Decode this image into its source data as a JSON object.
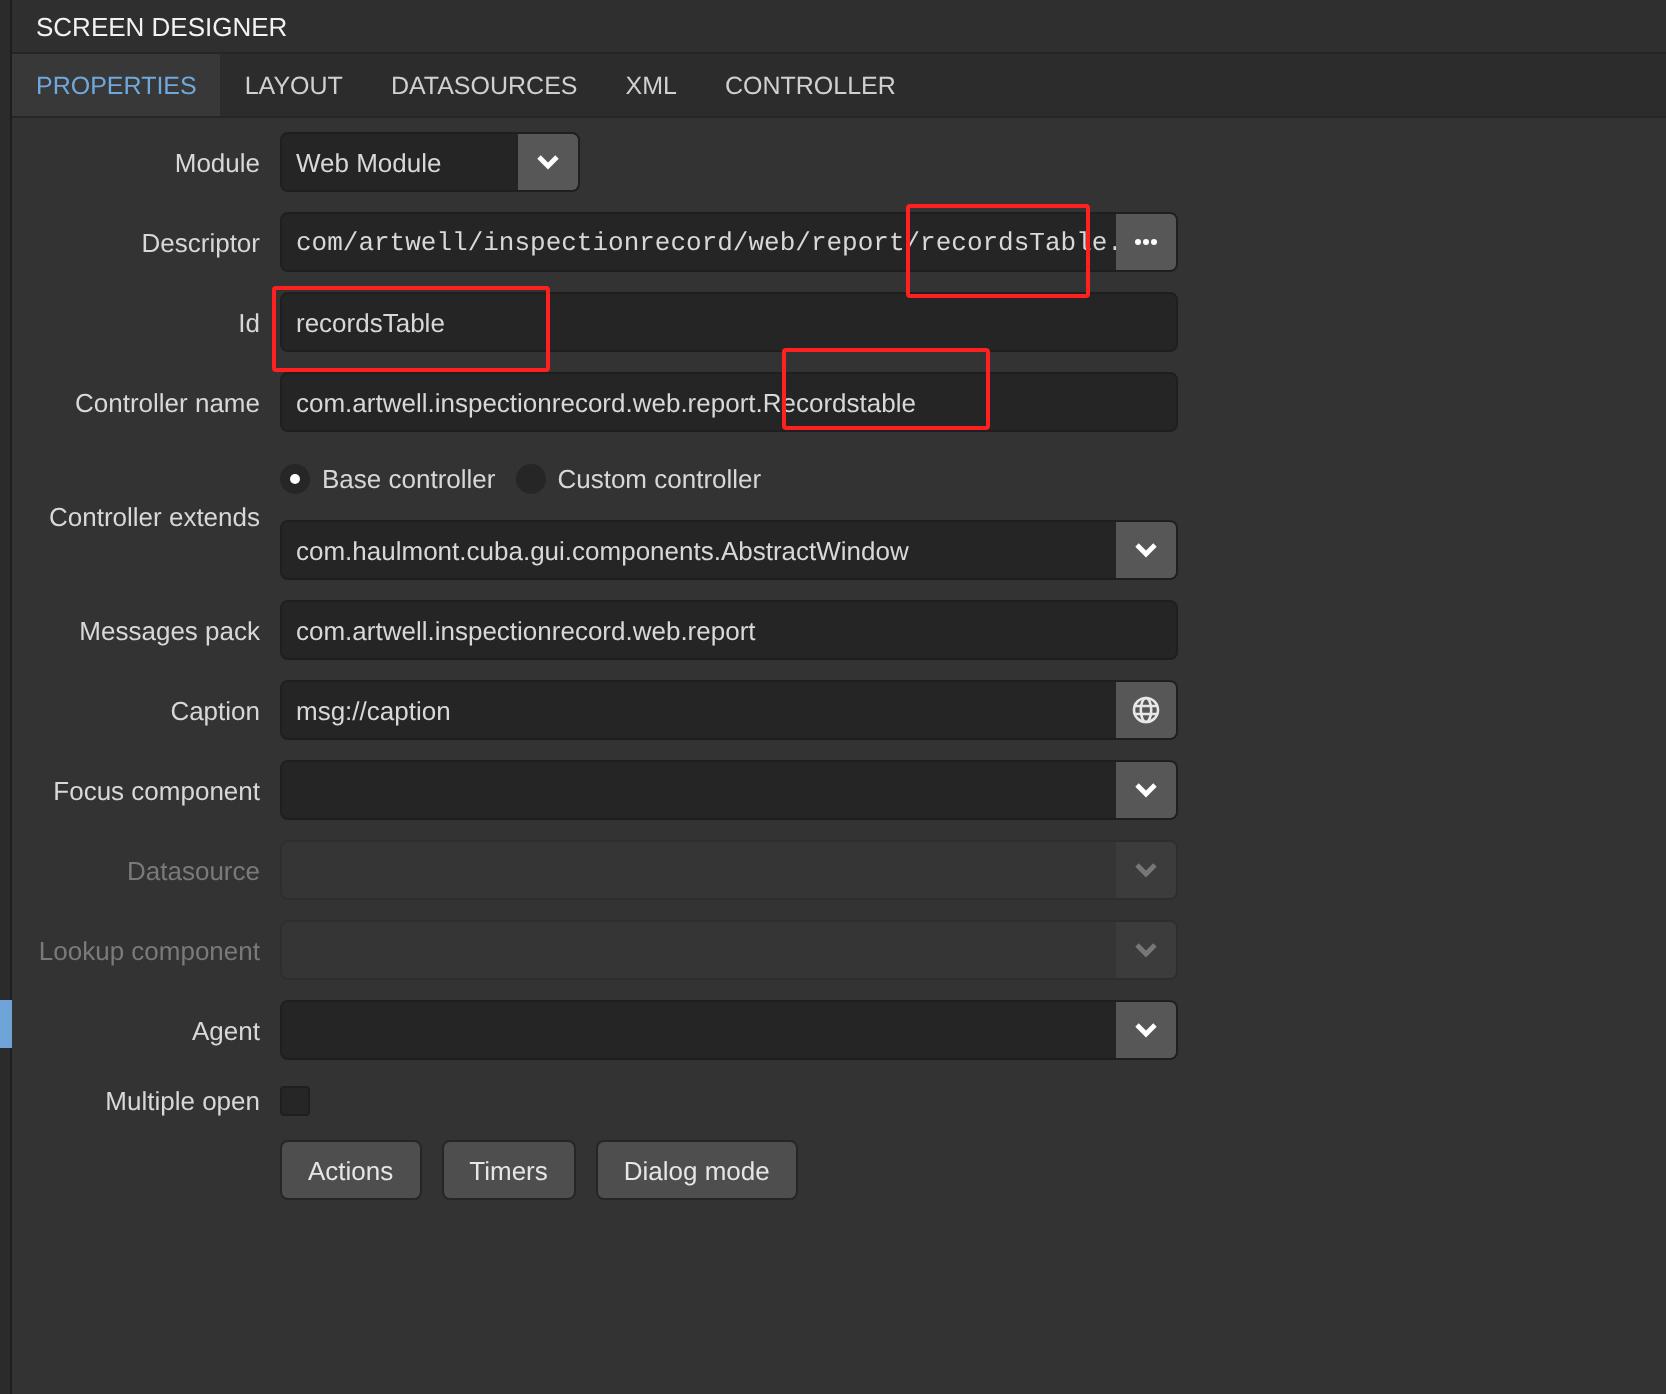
{
  "panel": {
    "title": "SCREEN DESIGNER"
  },
  "tabs": [
    {
      "label": "PROPERTIES",
      "selected": true
    },
    {
      "label": "LAYOUT",
      "selected": false
    },
    {
      "label": "DATASOURCES",
      "selected": false
    },
    {
      "label": "XML",
      "selected": false
    },
    {
      "label": "CONTROLLER",
      "selected": false
    }
  ],
  "rows": [
    {
      "kind": "select",
      "label": "Module",
      "value": "Web Module",
      "short": true,
      "disabled": false
    },
    {
      "kind": "browse",
      "label": "Descriptor",
      "value": "com/artwell/inspectionrecord/web/report/recordsTable.",
      "highlighted": true
    },
    {
      "kind": "text",
      "label": "Id",
      "value": "recordsTable",
      "highlighted": true
    },
    {
      "kind": "text",
      "label": "Controller name",
      "value": "com.artwell.inspectionrecord.web.report.Recordstable",
      "highlighted": true
    },
    {
      "kind": "radio-select",
      "label": "Controller extends",
      "options": [
        {
          "label": "Base controller",
          "selected": true
        },
        {
          "label": "Custom controller",
          "selected": false
        }
      ],
      "value": "com.haulmont.cuba.gui.components.AbstractWindow",
      "disabled": false
    },
    {
      "kind": "text",
      "label": "Messages pack",
      "value": "com.artwell.inspectionrecord.web.report"
    },
    {
      "kind": "localized",
      "label": "Caption",
      "value": "msg://caption"
    },
    {
      "kind": "select",
      "label": "Focus component",
      "disabled": false
    },
    {
      "kind": "select",
      "label": "Datasource",
      "disabled": true
    },
    {
      "kind": "select",
      "label": "Lookup component",
      "disabled": true
    },
    {
      "kind": "select",
      "label": "Agent",
      "disabled": false
    },
    {
      "kind": "checkbox",
      "label": "Multiple open",
      "checked": false
    }
  ],
  "buttons": [
    "Actions",
    "Timers",
    "Dialog mode"
  ]
}
